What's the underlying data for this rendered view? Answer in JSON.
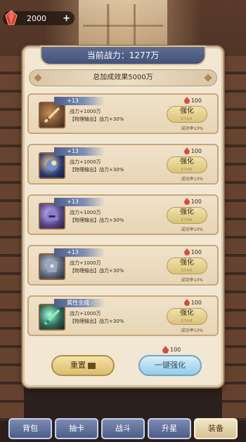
{
  "currency": {
    "amount": "2000",
    "plus": "+"
  },
  "panel": {
    "title": "当前战力：1277万",
    "total_banner": "总加成效果5000万"
  },
  "cards": [
    {
      "level": "+13",
      "stat1": "战力+1000万",
      "stat2": "【物理输出】战力+30%",
      "cost": "100",
      "button": "强化",
      "button_sub": "STAR",
      "rate": "成功率10%",
      "icon": "sword-icon"
    },
    {
      "level": "+13",
      "stat1": "战力+1000万",
      "stat2": "【物理输出】战力+30%",
      "cost": "100",
      "button": "强化",
      "button_sub": "STAR",
      "rate": "成功率10%",
      "icon": "gauntlet-icon"
    },
    {
      "level": "+13",
      "stat1": "战力+1000万",
      "stat2": "【物理输出】战力+30%",
      "cost": "100",
      "button": "强化",
      "button_sub": "STAR",
      "rate": "成功率10%",
      "icon": "helmet-icon"
    },
    {
      "level": "+13",
      "stat1": "战力+1000万",
      "stat2": "【物理输出】战力+30%",
      "cost": "100",
      "button": "强化",
      "button_sub": "STAR",
      "rate": "成功率10%",
      "icon": "armor-icon"
    },
    {
      "level": "属性全成",
      "stat1": "战力+1000万",
      "stat2": "【物理输出】战力+30%",
      "cost": "100",
      "button": "强化",
      "button_sub": "STAR",
      "rate": "成功率10%",
      "icon": "blade-icon"
    }
  ],
  "footer": {
    "cost": "100",
    "reset": "重置",
    "one_click": "一键强化"
  },
  "tabs": [
    {
      "label": "背包"
    },
    {
      "label": "抽卡"
    },
    {
      "label": "战斗"
    },
    {
      "label": "升星"
    },
    {
      "label": "装备",
      "active": true
    }
  ],
  "colors": {
    "title_bar": "#44527a",
    "card_bg": "#e7d6b6",
    "enhance_button": "#d9c27a",
    "one_click_button": "#95cbe8",
    "gem": "#e0463a"
  }
}
